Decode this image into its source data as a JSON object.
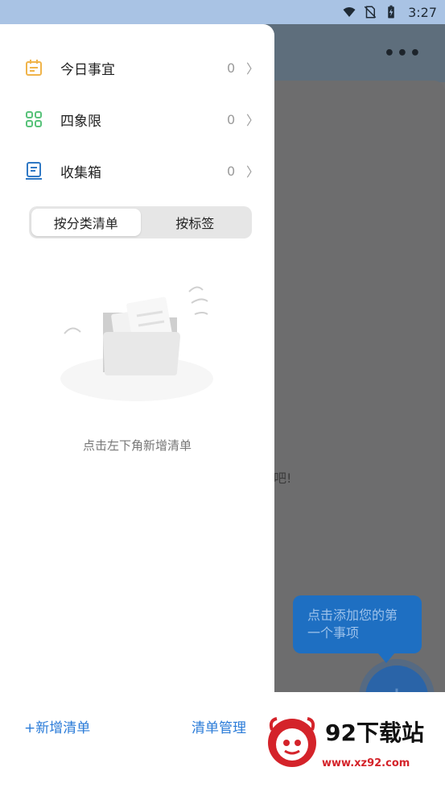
{
  "status_bar": {
    "time": "3:27"
  },
  "background": {
    "more_label": "•••",
    "hint_fragment": "吧!",
    "tooltip": "点击添加您的第一个事项",
    "fab_label": "+"
  },
  "drawer": {
    "menu": [
      {
        "label": "今日事宜",
        "count": "0",
        "icon": "calendar-icon"
      },
      {
        "label": "四象限",
        "count": "0",
        "icon": "quadrant-grid-icon"
      },
      {
        "label": "收集箱",
        "count": "0",
        "icon": "inbox-icon"
      }
    ],
    "chevron": "〉",
    "segment": {
      "options": [
        "按分类清单",
        "按标签"
      ],
      "selected": "按分类清单"
    },
    "empty_text": "点击左下角新增清单"
  },
  "bottom": {
    "add_list": "+新增清单",
    "manage_list": "清单管理"
  },
  "watermark": {
    "title": "92下载站",
    "url": "www.xz92.com"
  },
  "colors": {
    "accent": "#2a7bd8",
    "calendar_icon": "#f0b44a",
    "quadrant_icon": "#58c27a",
    "inbox_icon": "#2f78c4",
    "watermark_red": "#d4232a"
  }
}
